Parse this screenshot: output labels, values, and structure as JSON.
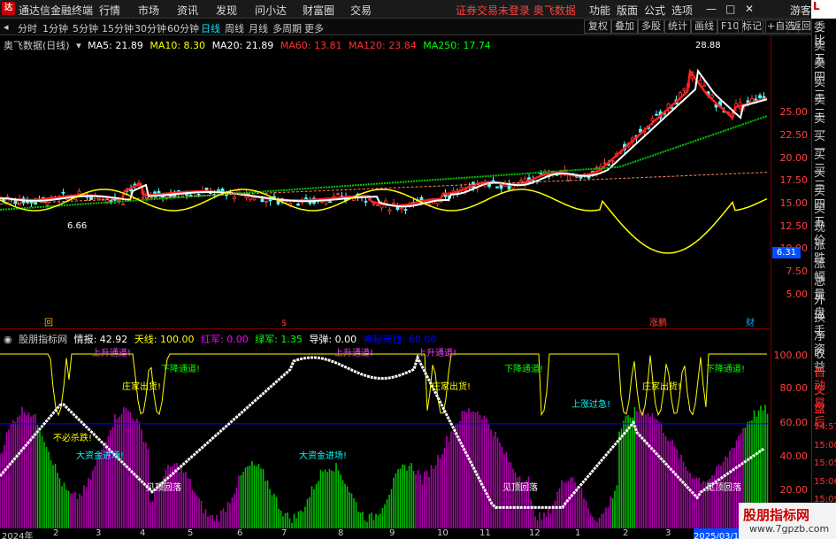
{
  "app": {
    "logo": "达",
    "title": "通达信金融终端",
    "menus": [
      "行情",
      "市场",
      "资讯",
      "发现",
      "问小达",
      "财富圈",
      "交易"
    ],
    "status": "证券交易未登录",
    "stock_name": "奥飞数据",
    "right": [
      "功能",
      "版面",
      "公式",
      "选项"
    ],
    "user": "游客",
    "corner": "L"
  },
  "toolbar": {
    "periods": [
      "分时",
      "1分钟",
      "5分钟",
      "15分钟",
      "30分钟",
      "60分钟",
      "日线",
      "周线",
      "月线",
      "多周期",
      "更多"
    ],
    "active": "日线",
    "right": [
      "复权",
      "叠加",
      "多股",
      "统计",
      "画线",
      "F10",
      "标记",
      "+自选",
      "返回"
    ]
  },
  "main": {
    "title": "奥飞数据(日线)",
    "ma": [
      {
        "label": "MA5: 21.89",
        "color": "#ffffff"
      },
      {
        "label": "MA10: 8.30",
        "color": "#ffff00"
      },
      {
        "label": "MA20: 21.89",
        "color": "#ffffff"
      },
      {
        "label": "MA60: 13.81",
        "color": "#ff3030"
      },
      {
        "label": "MA120: 23.84",
        "color": "#ff3030"
      },
      {
        "label": "MA250: 17.74",
        "color": "#00ff00"
      }
    ],
    "high_label": "28.88",
    "low_label": "6.66",
    "yticks": [
      "25.00",
      "22.50",
      "20.00",
      "17.50",
      "15.00",
      "12.50",
      "10.00",
      "7.50",
      "5.00"
    ],
    "current": "6.31",
    "markers": [
      "回",
      "$",
      "涨鹏",
      "财"
    ]
  },
  "indicator": {
    "name": "股朋指标网",
    "items": [
      {
        "label": "情报: 42.92",
        "color": "#ffffff"
      },
      {
        "label": "天线: 100.00",
        "color": "#ffff00"
      },
      {
        "label": "红军: 0.00",
        "color": "#ff00ff"
      },
      {
        "label": "绿军: 1.35",
        "color": "#00ff00"
      },
      {
        "label": "导弹: 0.00",
        "color": "#ffffff"
      },
      {
        "label": "神秘天线: 60.00",
        "color": "#0000ff"
      }
    ],
    "yticks": [
      "100.00",
      "80.00",
      "60.00",
      "40.00",
      "20.00"
    ],
    "annotations": [
      "上升通道!",
      "下降通道!",
      "庄家出货!",
      "不必杀跌!",
      "大资金进场!",
      "见顶回落",
      "大资金进场!",
      "上升通道!",
      "上升通道!",
      "庄家出货!",
      "下降通道!",
      "上涨过急!",
      "庄家出货!",
      "下降通道!",
      "见顶回落",
      "见顶回落"
    ]
  },
  "dates": [
    "2024年",
    "2",
    "3",
    "4",
    "5",
    "6",
    "7",
    "8",
    "9",
    "10",
    "11",
    "12",
    "1",
    "2",
    "3",
    "2025/03/11/二"
  ],
  "side": [
    "委比",
    "卖五",
    "卖四",
    "卖三",
    "卖二",
    "卖一",
    "买一",
    "买二",
    "买三",
    "买四",
    "买五",
    "现价",
    "涨跌",
    "涨幅",
    "总量",
    "外盘",
    "换手",
    "净资",
    "收益",
    "自动",
    "交易",
    "盘后",
    "14:57",
    "15:00",
    "15:05",
    "15:06",
    "15:09",
    "15:10"
  ],
  "watermark": {
    "line1": "股朋指标网",
    "line2": "www.7gpzb.com"
  },
  "chart_data": {
    "type": "line",
    "title": "奥飞数据(日线)",
    "ylim": [
      5,
      28.88
    ],
    "series": [
      {
        "name": "MA5",
        "values": []
      }
    ]
  }
}
